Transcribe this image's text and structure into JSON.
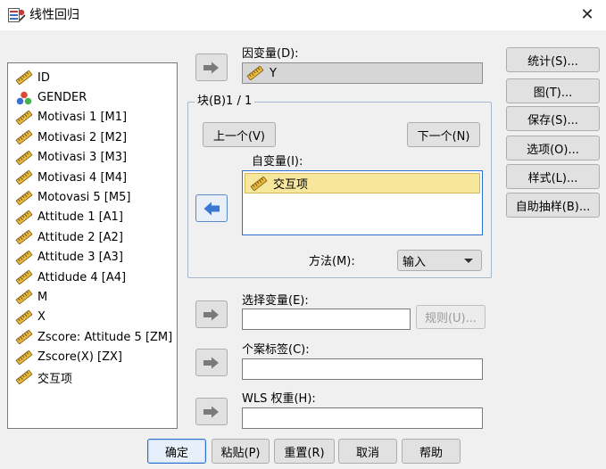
{
  "window": {
    "title": "线性回归",
    "close_glyph": "✕",
    "icon": "regression-app-icon"
  },
  "variables": [
    {
      "label": "ID",
      "icon": "scale-ruler-icon"
    },
    {
      "label": "GENDER",
      "icon": "nominal-balls-icon"
    },
    {
      "label": "Motivasi 1 [M1]",
      "icon": "scale-ruler-icon"
    },
    {
      "label": "Motivasi 2 [M2]",
      "icon": "scale-ruler-icon"
    },
    {
      "label": "Motivasi 3 [M3]",
      "icon": "scale-ruler-icon"
    },
    {
      "label": "Motivasi 4 [M4]",
      "icon": "scale-ruler-icon"
    },
    {
      "label": "Motovasi 5 [M5]",
      "icon": "scale-ruler-icon"
    },
    {
      "label": "Attitude 1 [A1]",
      "icon": "scale-ruler-icon"
    },
    {
      "label": "Attitude 2 [A2]",
      "icon": "scale-ruler-icon"
    },
    {
      "label": "Attitude 3 [A3]",
      "icon": "scale-ruler-icon"
    },
    {
      "label": "Attidude 4 [A4]",
      "icon": "scale-ruler-icon"
    },
    {
      "label": "M",
      "icon": "scale-ruler-icon"
    },
    {
      "label": "X",
      "icon": "scale-ruler-icon"
    },
    {
      "label": "Zscore:  Attitude 5 [ZM]",
      "icon": "scale-ruler-icon"
    },
    {
      "label": "Zscore(X) [ZX]",
      "icon": "scale-ruler-icon"
    },
    {
      "label": "交互项",
      "icon": "scale-ruler-icon"
    }
  ],
  "dependent": {
    "label": "因变量(D):",
    "value": "Y"
  },
  "block": {
    "title": "块(B)1 / 1",
    "prev_label": "上一个(V)",
    "next_label": "下一个(N)",
    "independent_label": "自变量(I):",
    "independent_items": [
      "交互项"
    ],
    "method_label": "方法(M):",
    "method_value": "输入"
  },
  "selection": {
    "label": "选择变量(E):",
    "value": "",
    "rule_label": "规则(U)..."
  },
  "case_labels": {
    "label": "个案标签(C):",
    "value": ""
  },
  "wls": {
    "label": "WLS 权重(H):",
    "value": ""
  },
  "side_buttons": [
    {
      "name": "statistics-button",
      "label": "统计(S)..."
    },
    {
      "name": "plots-button",
      "label": "图(T)..."
    },
    {
      "name": "save-button",
      "label": "保存(S)..."
    },
    {
      "name": "options-button",
      "label": "选项(O)..."
    },
    {
      "name": "style-button",
      "label": "样式(L)..."
    },
    {
      "name": "bootstrap-button",
      "label": "自助抽样(B)..."
    }
  ],
  "bottom_buttons": [
    {
      "name": "ok-button",
      "label": "确定"
    },
    {
      "name": "paste-button",
      "label": "粘贴(P)"
    },
    {
      "name": "reset-button",
      "label": "重置(R)"
    },
    {
      "name": "cancel-button",
      "label": "取消"
    },
    {
      "name": "help-button",
      "label": "帮助"
    }
  ],
  "colors": {
    "accent_blue": "#2b6fd0",
    "arrow_blue": "#3a78d2",
    "selected_item": "#f7e79c",
    "dialog_bg": "#f0f0f0"
  }
}
